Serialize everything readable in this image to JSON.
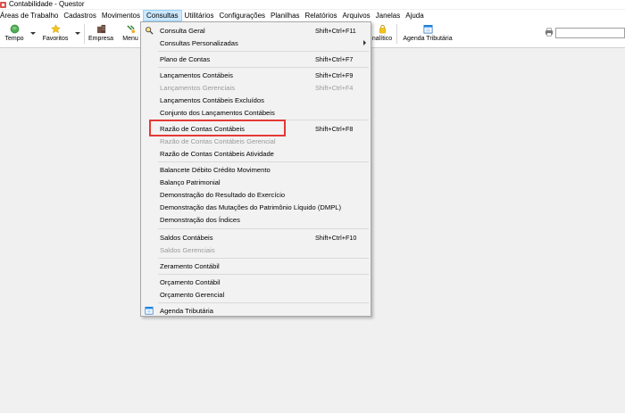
{
  "window": {
    "title": "Contabilidade - Questor"
  },
  "menubar": [
    "Áreas de Trabalho",
    "Cadastros",
    "Movimentos",
    "Consultas",
    "Utilitários",
    "Configurações",
    "Planilhas",
    "Relatórios",
    "Arquivos",
    "Janelas",
    "Ajuda"
  ],
  "toolbar": {
    "tempo": "Tempo",
    "favoritos": "Favoritos",
    "empresa": "Empresa",
    "menu": "Menu",
    "analitico": "nalítico",
    "agenda": "Agenda Tributária",
    "search_value": ""
  },
  "consultas_menu": {
    "consulta_geral": {
      "label": "Consulta Geral",
      "shortcut": "Shift+Ctrl+F11"
    },
    "consultas_personalizadas": {
      "label": "Consultas Personalizadas"
    },
    "plano_de_contas": {
      "label": "Plano de Contas",
      "shortcut": "Shift+Ctrl+F7"
    },
    "lancamentos_contabeis": {
      "label": "Lançamentos Contábeis",
      "shortcut": "Shift+Ctrl+F9"
    },
    "lancamentos_gerenciais": {
      "label": "Lançamentos Gerenciais",
      "shortcut": "Shift+Ctrl+F4"
    },
    "lancamentos_excluidos": {
      "label": "Lançamentos Contábeis Excluídos"
    },
    "conjunto_lancamentos": {
      "label": "Conjunto dos Lançamentos Contábeis"
    },
    "razao_contas_contabeis": {
      "label": "Razão de Contas Contábeis",
      "shortcut": "Shift+Ctrl+F8"
    },
    "razao_gerencial": {
      "label": "Razão de Contas Contábeis Gerencial"
    },
    "razao_atividade": {
      "label": "Razão de Contas Contábeis Atividade"
    },
    "balancete": {
      "label": "Balancete Débito Crédito Movimento"
    },
    "balanco": {
      "label": "Balanço Patrimonial"
    },
    "dre": {
      "label": "Demonstração do Resultado do Exercício"
    },
    "dmpl": {
      "label": "Demonstração das Mutações do Patrimônio Líquido (DMPL)"
    },
    "indices": {
      "label": "Demonstração dos Índices"
    },
    "saldos_contabeis": {
      "label": "Saldos Contábeis",
      "shortcut": "Shift+Ctrl+F10"
    },
    "saldos_gerenciais": {
      "label": "Saldos Gerenciais"
    },
    "zeramento": {
      "label": "Zeramento Contábil"
    },
    "orcamento_contabil": {
      "label": "Orçamento Contábil"
    },
    "orcamento_gerencial": {
      "label": "Orçamento Gerencial"
    },
    "agenda_tributaria": {
      "label": "Agenda Tributária"
    }
  },
  "colors": {
    "highlight_box": "#e53935",
    "active_menu_bg": "#cce8ff"
  }
}
